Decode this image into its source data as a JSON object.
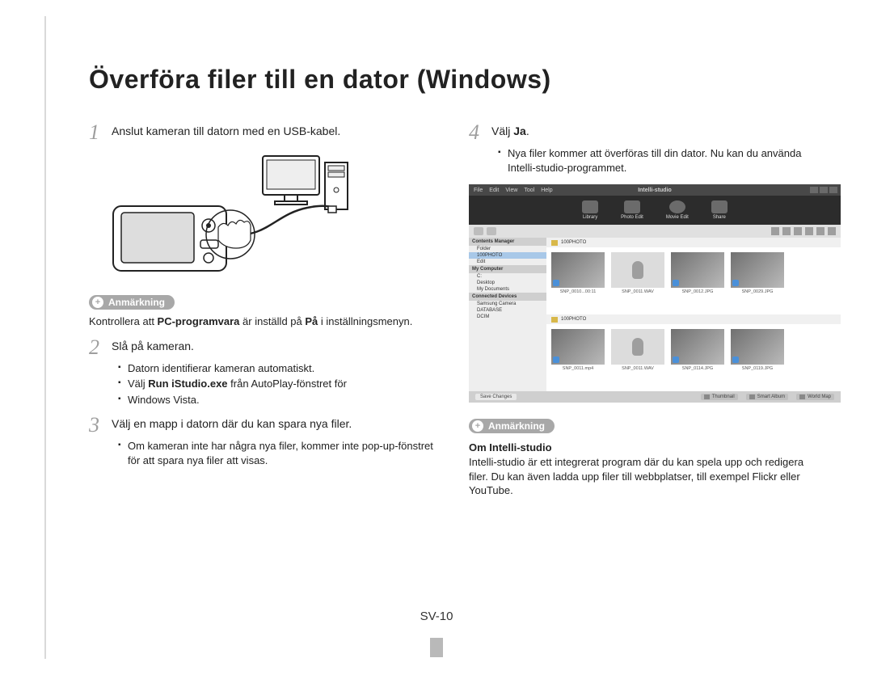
{
  "title": "Överföra filer till en dator (Windows)",
  "page_number": "SV-10",
  "left": {
    "step1": {
      "num": "1",
      "text": "Anslut kameran till datorn med en USB-kabel."
    },
    "note_label": "Anmärkning",
    "note_p1": "Kontrollera att ",
    "note_p2_bold": "PC-programvara",
    "note_p3": " är inställd på ",
    "note_p4_bold": "På",
    "note_p5": " i inställningsmenyn.",
    "step2": {
      "num": "2",
      "text": "Slå på kameran."
    },
    "step2_b1": "Datorn identifierar kameran automatiskt.",
    "step2_b2a": "Välj ",
    "step2_b2b_bold": "Run iStudio.exe",
    "step2_b2c": " från AutoPlay-fönstret för",
    "step2_b3": "Windows Vista.",
    "step3": {
      "num": "3",
      "text": "Välj en mapp i datorn där du kan spara nya filer."
    },
    "step3_b1": "Om kameran inte har några nya filer, kommer inte pop-up-fönstret för att spara nya filer att visas."
  },
  "right": {
    "step4": {
      "num": "4",
      "text_a": "Välj ",
      "text_b_bold": "Ja",
      "text_c": "."
    },
    "step4_b1": "Nya filer kommer att överföras till din dator. Nu kan du använda Intelli-studio-programmet.",
    "note_label": "Anmärkning",
    "subhead": "Om Intelli-studio",
    "note_body": "Intelli-studio är ett integrerat program där du kan spela upp och redigera filer. Du kan även ladda upp filer till webbplatser, till exempel Flickr eller YouTube."
  },
  "app": {
    "title": "Intelli-studio",
    "menu": [
      "File",
      "Edit",
      "View",
      "Tool",
      "Help"
    ],
    "tabs": [
      "Library",
      "Photo Edit",
      "Movie Edit",
      "Share"
    ],
    "side": {
      "head1": "Contents Manager",
      "items1": [
        "Folder",
        "100PHOTO",
        "Edit"
      ],
      "head2": "My Computer",
      "items2": [
        "C:",
        "Desktop",
        "My Documents"
      ],
      "head3": "Connected Devices",
      "items3": [
        "Samsung Camera",
        "DATABASE",
        "DCIM"
      ]
    },
    "folder_top": "100PHOTO",
    "thumbs_top": [
      "SNP_0010...00:11",
      "SNP_0011.WAV",
      "SNP_0012.JPG",
      "SNP_0029.JPG"
    ],
    "folder_bottom": "100PHOTO",
    "thumbs_bottom": [
      "SNP_0011.mp4",
      "SNP_0011.WAV",
      "SNP_0114.JPG",
      "SNP_0119.JPG"
    ],
    "status": {
      "save": "Save Changes",
      "views": [
        "Thumbnail",
        "Smart Album",
        "World Map"
      ]
    }
  }
}
